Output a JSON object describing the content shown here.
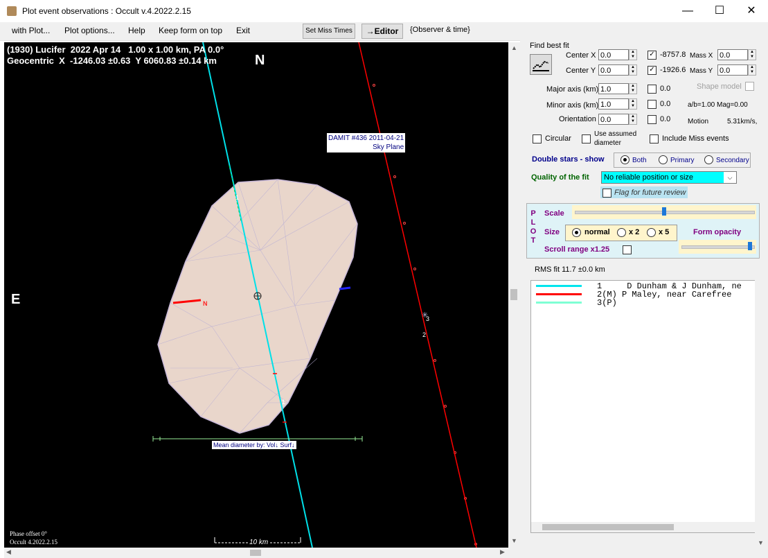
{
  "window": {
    "title": "Plot event observations : Occult v.4.2022.2.15"
  },
  "menu": {
    "items": [
      "with Plot...",
      "Plot options...",
      "Help",
      "Keep form on top",
      "Exit"
    ],
    "set_miss_times": "Set Miss Times",
    "editor": "→Editor",
    "observer_time": "{Observer & time}"
  },
  "plot": {
    "header_line1": "(1930) Lucifer  2022 Apr 14   1.00 x 1.00 km, PA 0.0°",
    "header_line2": "Geocentric  X  -1246.03 ±0.63  Y 6060.83 ±0.14 km",
    "north": "N",
    "east": "E",
    "damit_line1": "DAMIT #436 2011-04-21",
    "damit_line2": "Sky Plane",
    "mean_diameter": "Mean diameter by: Vol↓ Surf↓",
    "phase_offset": "Phase offset 0°",
    "version": "Occult 4.2022.2.15",
    "scale_bar": "10 km",
    "chord_labels": [
      "1",
      "1",
      "2",
      "3"
    ],
    "small_n": "N"
  },
  "fit": {
    "title": "Find best fit",
    "center_x_label": "Center X",
    "center_x": "0.0",
    "center_y_label": "Center Y",
    "center_y": "0.0",
    "fixed_x": "-8757.8",
    "fixed_y": "-1926.6",
    "mass_x_label": "Mass X",
    "mass_x": "0.0",
    "mass_y_label": "Mass Y",
    "mass_y": "0.0",
    "major_label": "Major axis (km)",
    "major": "1.0",
    "major_chk": "0.0",
    "minor_label": "Minor axis (km)",
    "minor": "1.0",
    "minor_chk": "0.0",
    "orient_label": "Orientation",
    "orient": "0.0",
    "orient_chk": "0.0",
    "shape_model": "Shape model",
    "ab_mag": "a/b=1.00  Mag=0.00",
    "motion_label": "Motion",
    "motion": "5.31km/s,",
    "circular": "Circular",
    "use_assumed": "Use assumed",
    "diameter": "diameter",
    "include_miss": "Include Miss events"
  },
  "double_stars": {
    "label": "Double stars - show",
    "both": "Both",
    "primary": "Primary",
    "secondary": "Secondary"
  },
  "quality": {
    "label": "Quality of the fit",
    "value": "No reliable position or size",
    "flag": "Flag for future review"
  },
  "plotbox": {
    "letters": [
      "P",
      "L",
      "O",
      "T"
    ],
    "scale": "Scale",
    "size": "Size",
    "normal": "normal",
    "x2": "x 2",
    "x5": "x 5",
    "form_opacity": "Form opacity",
    "scroll_range": "Scroll range x1.25"
  },
  "rms": "RMS fit 11.7 ±0.0 km",
  "legend": [
    {
      "num": "1   ",
      "text": "D Dunham & J Dunham, ne",
      "color": "#00e5ee"
    },
    {
      "num": "2(M)",
      "text": "P Maley, near Carefree",
      "color": "#ff0000"
    },
    {
      "num": "3(P)",
      "text": "",
      "color": "#7fffd4"
    }
  ],
  "colors": {
    "accent_cyan": "#00ffff",
    "select_bg": "#00ffff",
    "red": "#ff0000"
  }
}
